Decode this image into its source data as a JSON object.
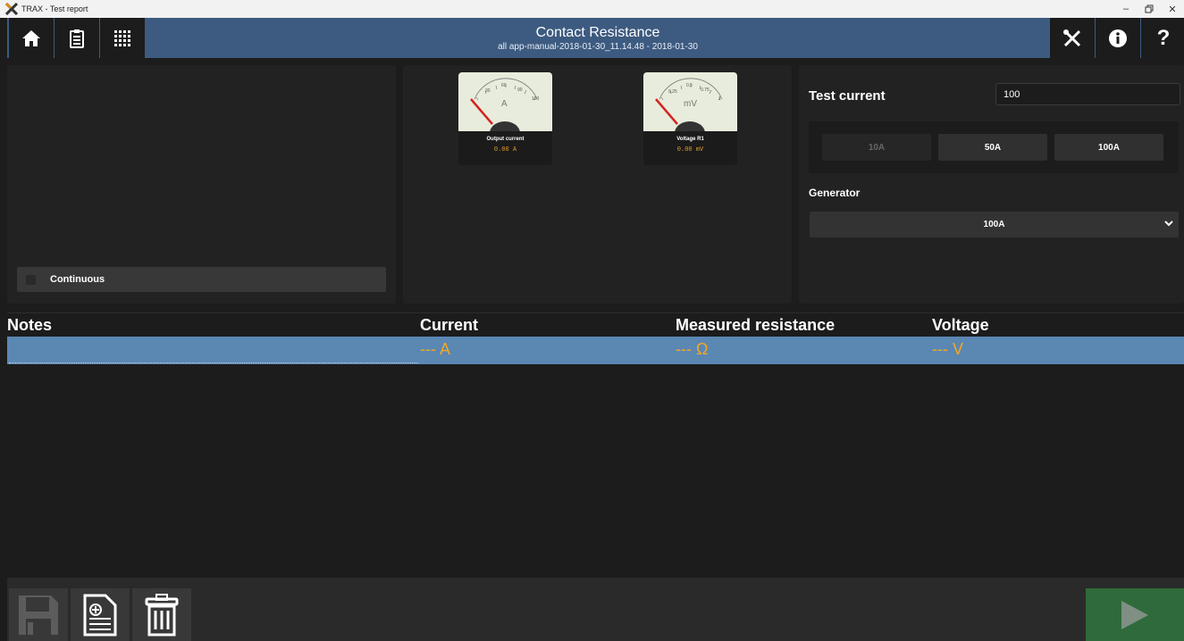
{
  "window": {
    "title": "TRAX - Test report",
    "controls": [
      "–",
      "\u0002",
      "✕"
    ]
  },
  "header": {
    "title": "Contact Resistance",
    "subtitle": "all app-manual-2018-01-30_11.14.48 - 2018-01-30",
    "nav_icons": [
      "home-icon",
      "clipboard-icon",
      "apps-grid-icon"
    ],
    "right_icons": [
      "tools-icon",
      "info-icon",
      "help-icon"
    ],
    "help_glyph": "?"
  },
  "left_panel": {
    "continuous_label": "Continuous",
    "continuous_checked": false
  },
  "meters": [
    {
      "unit": "A",
      "ticks": [
        "30",
        "60",
        "90",
        "120"
      ],
      "name": "Output current",
      "value": "0.00 A"
    },
    {
      "unit": "mV",
      "ticks": [
        "0.25",
        "0.5",
        "0.75",
        "1"
      ],
      "name": "Voltage R1",
      "value": "0.00 mV"
    }
  ],
  "settings": {
    "test_current_label": "Test current",
    "test_current_value": "100",
    "range_buttons": [
      {
        "label": "10A",
        "enabled": false
      },
      {
        "label": "50A",
        "enabled": true
      },
      {
        "label": "100A",
        "enabled": true
      }
    ],
    "generator_label": "Generator",
    "generator_value": "100A"
  },
  "table": {
    "headers": [
      "Notes",
      "Current",
      "Measured resistance",
      "Voltage"
    ],
    "rows": [
      {
        "notes": "",
        "current": "--- A",
        "resistance": "--- Ω",
        "voltage": "--- V"
      }
    ]
  },
  "toolbar": {
    "buttons": [
      "save-icon",
      "add-report-icon",
      "trash-icon"
    ],
    "run_icon": "play-icon"
  },
  "colors": {
    "accent": "#3d5b80",
    "selected_row": "#5b87b3",
    "value_orange": "#f5a623",
    "run_green": "#2f6b3a"
  }
}
